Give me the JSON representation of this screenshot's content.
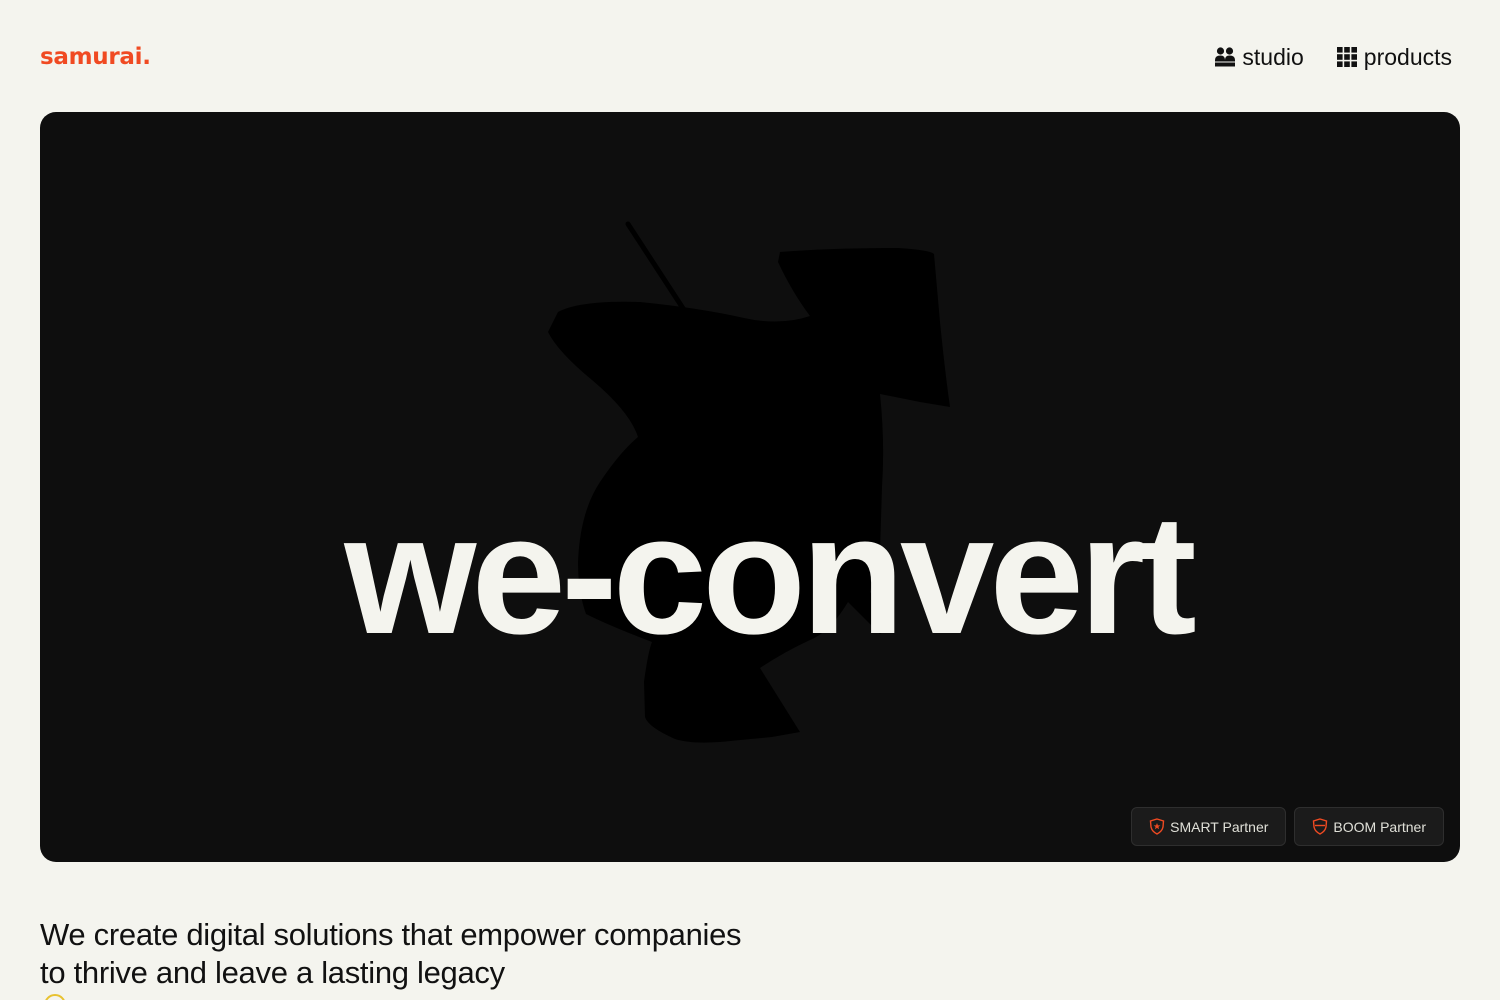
{
  "brand": {
    "logo": "samurai."
  },
  "nav": {
    "items": [
      {
        "label": "studio",
        "icon": "people-icon"
      },
      {
        "label": "products",
        "icon": "grid-icon"
      }
    ]
  },
  "hero": {
    "headline": "we-convert",
    "badges": [
      {
        "label": "SMART Partner",
        "icon": "shield-star-icon"
      },
      {
        "label": "BOOM Partner",
        "icon": "shield-heart-icon"
      }
    ]
  },
  "intro": {
    "text": "We create digital solutions that empower companies to thrive and leave a lasting legacy"
  },
  "colors": {
    "background": "#f4f4ee",
    "accent": "#f04a22",
    "hero_background": "#0e0e0e",
    "hero_text": "#f4f4ee"
  }
}
